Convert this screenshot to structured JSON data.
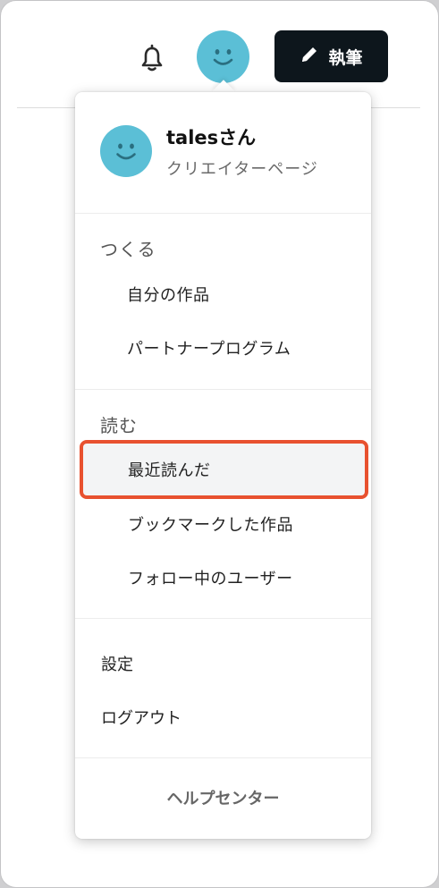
{
  "header": {
    "bell_icon": "bell-icon",
    "avatar_icon": "smiley-avatar",
    "write_button_label": "執筆",
    "write_button_icon": "pencil-icon",
    "avatar_color": "#5bbfd6",
    "button_bg": "#0d161c"
  },
  "menu": {
    "profile": {
      "name": "talesさん",
      "subtitle": "クリエイターページ"
    },
    "sections": [
      {
        "title": "つくる",
        "items": [
          "自分の作品",
          "パートナープログラム"
        ]
      },
      {
        "title": "読む",
        "items": [
          "最近読んだ",
          "ブックマークした作品",
          "フォロー中のユーザー"
        ]
      }
    ],
    "settings_label": "設定",
    "logout_label": "ログアウト",
    "help_label": "ヘルプセンター",
    "highlight_color": "#e8512f"
  }
}
